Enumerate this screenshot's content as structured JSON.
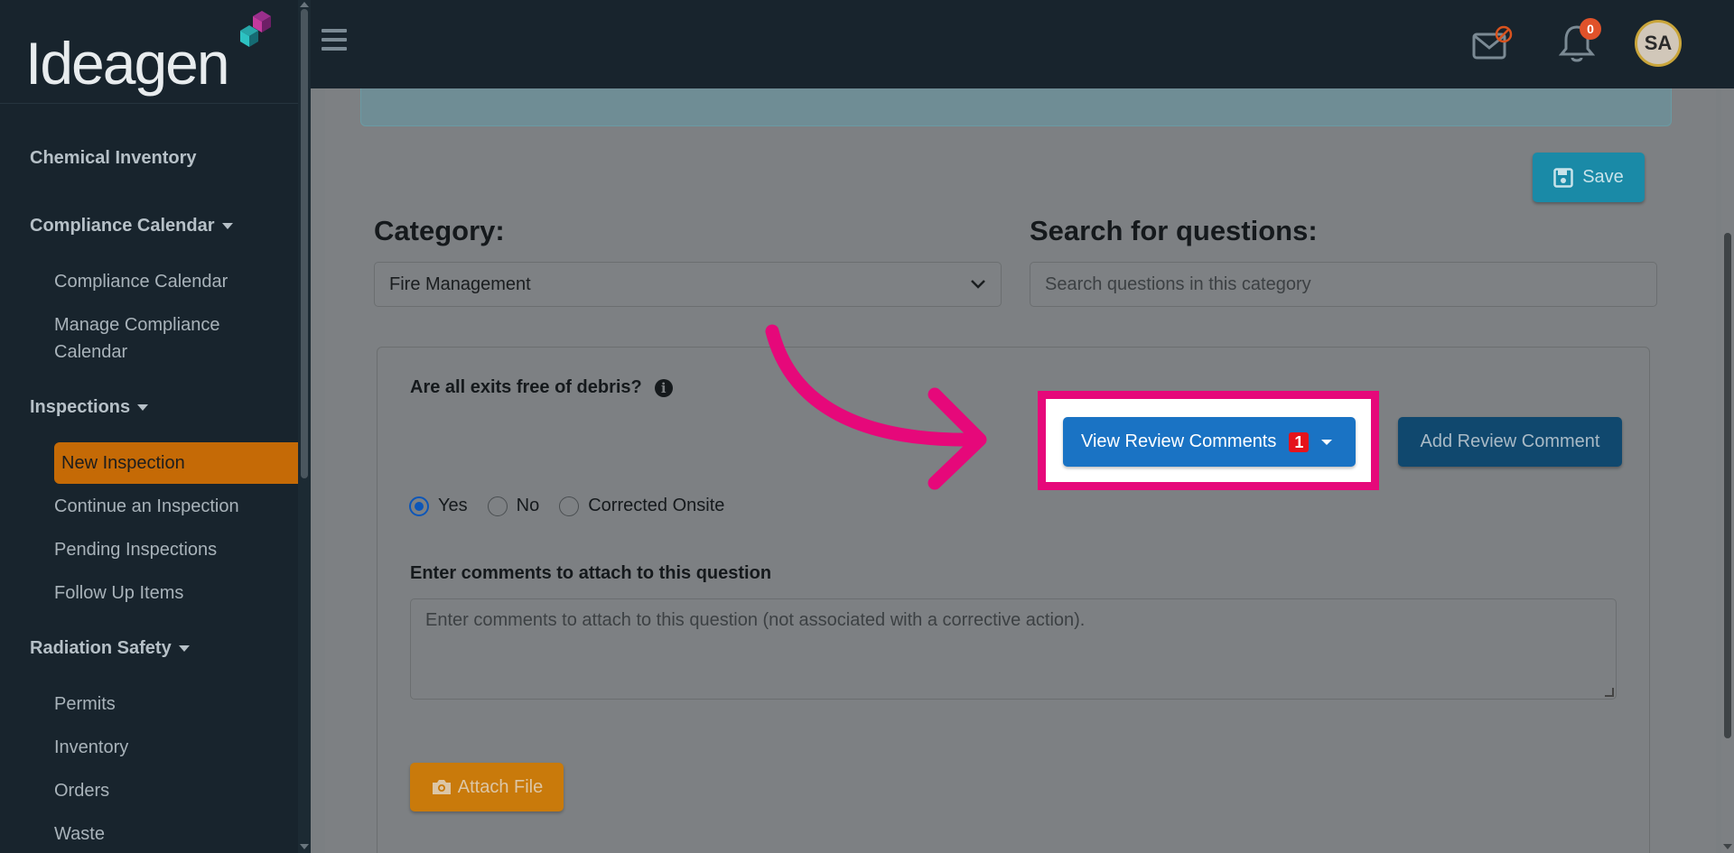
{
  "brand": {
    "logo_text": "Ideagen"
  },
  "sidebar": {
    "sections": [
      {
        "label": "Chemical Inventory"
      },
      {
        "label": "Compliance Calendar"
      },
      {
        "label": "Inspections"
      },
      {
        "label": "Radiation Safety"
      }
    ],
    "items": {
      "compliance_calendar": "Compliance Calendar",
      "manage_compliance_calendar": "Manage Compliance Calendar",
      "new_inspection": "New Inspection",
      "continue_inspection": "Continue an Inspection",
      "pending_inspections": "Pending Inspections",
      "follow_up_items": "Follow Up Items",
      "permits": "Permits",
      "inventory": "Inventory",
      "orders": "Orders",
      "waste": "Waste"
    }
  },
  "topbar": {
    "notification_count": "0",
    "avatar_initials": "SA"
  },
  "toolbar": {
    "save_label": "Save"
  },
  "form": {
    "category_label": "Category:",
    "category_value": "Fire Management",
    "search_label": "Search for questions:",
    "search_placeholder": "Search questions in this category"
  },
  "question": {
    "text": "Are all exits free of debris?",
    "view_comments_label": "View Review Comments",
    "view_comments_count": "1",
    "add_comment_label": "Add Review Comment",
    "options": [
      "Yes",
      "No",
      "Corrected Onsite"
    ],
    "selected_option": "Yes",
    "comments_label": "Enter comments to attach to this question",
    "comments_placeholder": "Enter comments to attach to this question (not associated with a corrective action).",
    "attach_label": "Attach File"
  },
  "colors": {
    "highlight": "#e6087a",
    "active_nav": "#c56a06",
    "primary_button": "#1a73c4",
    "attach_button": "#c97a0b"
  }
}
